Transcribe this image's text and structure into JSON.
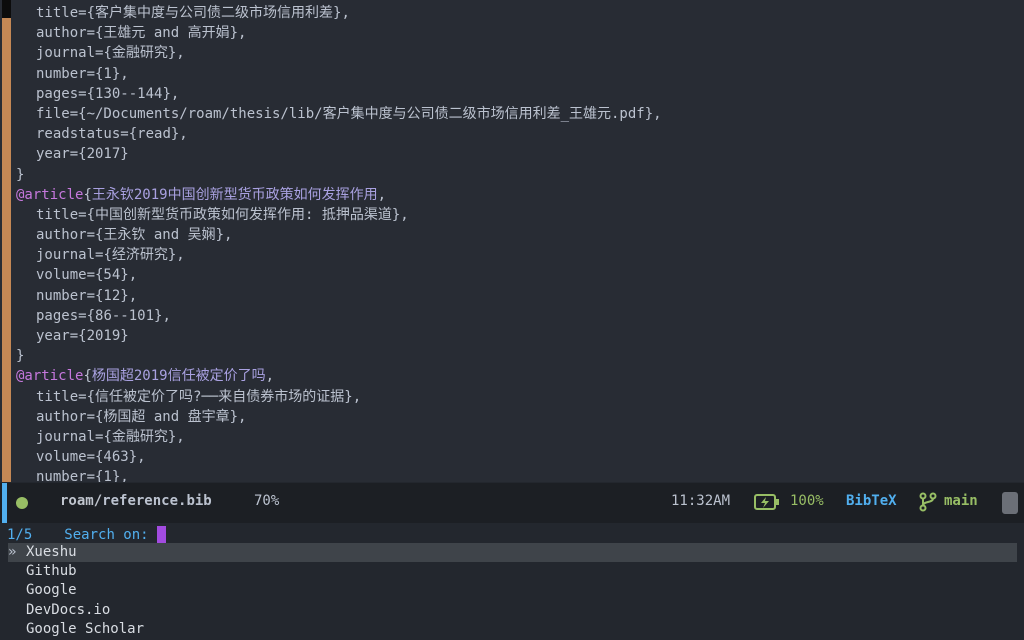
{
  "editor": {
    "lines": [
      {
        "indent": true,
        "parts": [
          {
            "t": "field",
            "v": "title"
          },
          {
            "t": "punct",
            "v": "={客户集中度与公司债二级市场信用利差},"
          }
        ]
      },
      {
        "indent": true,
        "parts": [
          {
            "t": "field",
            "v": "author"
          },
          {
            "t": "punct",
            "v": "={王雄元 and 高开娟},"
          }
        ]
      },
      {
        "indent": true,
        "parts": [
          {
            "t": "field",
            "v": "journal"
          },
          {
            "t": "punct",
            "v": "={金融研究},"
          }
        ]
      },
      {
        "indent": true,
        "parts": [
          {
            "t": "field",
            "v": "number"
          },
          {
            "t": "punct",
            "v": "={1},"
          }
        ]
      },
      {
        "indent": true,
        "parts": [
          {
            "t": "field",
            "v": "pages"
          },
          {
            "t": "punct",
            "v": "={130--144},"
          }
        ]
      },
      {
        "indent": true,
        "parts": [
          {
            "t": "field",
            "v": "file"
          },
          {
            "t": "punct",
            "v": "={~/Documents/roam/thesis/lib/客户集中度与公司债二级市场信用利差_王雄元.pdf},"
          }
        ]
      },
      {
        "indent": true,
        "parts": [
          {
            "t": "field",
            "v": "readstatus"
          },
          {
            "t": "punct",
            "v": "={read},"
          }
        ]
      },
      {
        "indent": true,
        "parts": [
          {
            "t": "field",
            "v": "year"
          },
          {
            "t": "punct",
            "v": "={2017}"
          }
        ]
      },
      {
        "indent": false,
        "parts": [
          {
            "t": "punct",
            "v": "}"
          }
        ]
      },
      {
        "indent": false,
        "parts": [
          {
            "t": "kw",
            "v": "@article"
          },
          {
            "t": "punct",
            "v": "{"
          },
          {
            "t": "key",
            "v": "王永钦2019中国创新型货币政策如何发挥作用"
          },
          {
            "t": "punct",
            "v": ","
          }
        ]
      },
      {
        "indent": true,
        "parts": [
          {
            "t": "field",
            "v": "title"
          },
          {
            "t": "punct",
            "v": "={中国创新型货币政策如何发挥作用: 抵押品渠道},"
          }
        ]
      },
      {
        "indent": true,
        "parts": [
          {
            "t": "field",
            "v": "author"
          },
          {
            "t": "punct",
            "v": "={王永钦 and 吴娴},"
          }
        ]
      },
      {
        "indent": true,
        "parts": [
          {
            "t": "field",
            "v": "journal"
          },
          {
            "t": "punct",
            "v": "={经济研究},"
          }
        ]
      },
      {
        "indent": true,
        "parts": [
          {
            "t": "field",
            "v": "volume"
          },
          {
            "t": "punct",
            "v": "={54},"
          }
        ]
      },
      {
        "indent": true,
        "parts": [
          {
            "t": "field",
            "v": "number"
          },
          {
            "t": "punct",
            "v": "={12},"
          }
        ]
      },
      {
        "indent": true,
        "parts": [
          {
            "t": "field",
            "v": "pages"
          },
          {
            "t": "punct",
            "v": "={86--101},"
          }
        ]
      },
      {
        "indent": true,
        "parts": [
          {
            "t": "field",
            "v": "year"
          },
          {
            "t": "punct",
            "v": "={2019}"
          }
        ]
      },
      {
        "indent": false,
        "parts": [
          {
            "t": "punct",
            "v": "}"
          }
        ]
      },
      {
        "indent": false,
        "parts": [
          {
            "t": "kw",
            "v": "@article"
          },
          {
            "t": "punct",
            "v": "{"
          },
          {
            "t": "key",
            "v": "杨国超2019信任被定价了吗"
          },
          {
            "t": "punct",
            "v": ","
          }
        ]
      },
      {
        "indent": true,
        "parts": [
          {
            "t": "field",
            "v": "title"
          },
          {
            "t": "punct",
            "v": "={信任被定价了吗?──来自债券市场的证据},"
          }
        ]
      },
      {
        "indent": true,
        "parts": [
          {
            "t": "field",
            "v": "author"
          },
          {
            "t": "punct",
            "v": "={杨国超 and 盘宇章},"
          }
        ]
      },
      {
        "indent": true,
        "parts": [
          {
            "t": "field",
            "v": "journal"
          },
          {
            "t": "punct",
            "v": "={金融研究},"
          }
        ]
      },
      {
        "indent": true,
        "parts": [
          {
            "t": "field",
            "v": "volume"
          },
          {
            "t": "punct",
            "v": "={463},"
          }
        ]
      },
      {
        "indent": true,
        "parts": [
          {
            "t": "field",
            "v": "number"
          },
          {
            "t": "punct",
            "v": "={1},"
          }
        ]
      }
    ]
  },
  "modeline": {
    "dir": "roam/",
    "file": "reference.bib",
    "percent": "70%",
    "time": "11:32AM",
    "battery": "100%",
    "major_mode": "BibTeX",
    "branch": "main",
    "colors": {
      "ok": "#98be65",
      "mode": "#51afef"
    }
  },
  "minibuffer": {
    "count": "1/5",
    "prompt": "Search on:",
    "candidates": [
      {
        "label": "Xueshu",
        "selected": true
      },
      {
        "label": "Github",
        "selected": false
      },
      {
        "label": "Google",
        "selected": false
      },
      {
        "label": "DevDocs.io",
        "selected": false
      },
      {
        "label": "Google Scholar",
        "selected": false
      }
    ],
    "selected_marker": "»"
  }
}
